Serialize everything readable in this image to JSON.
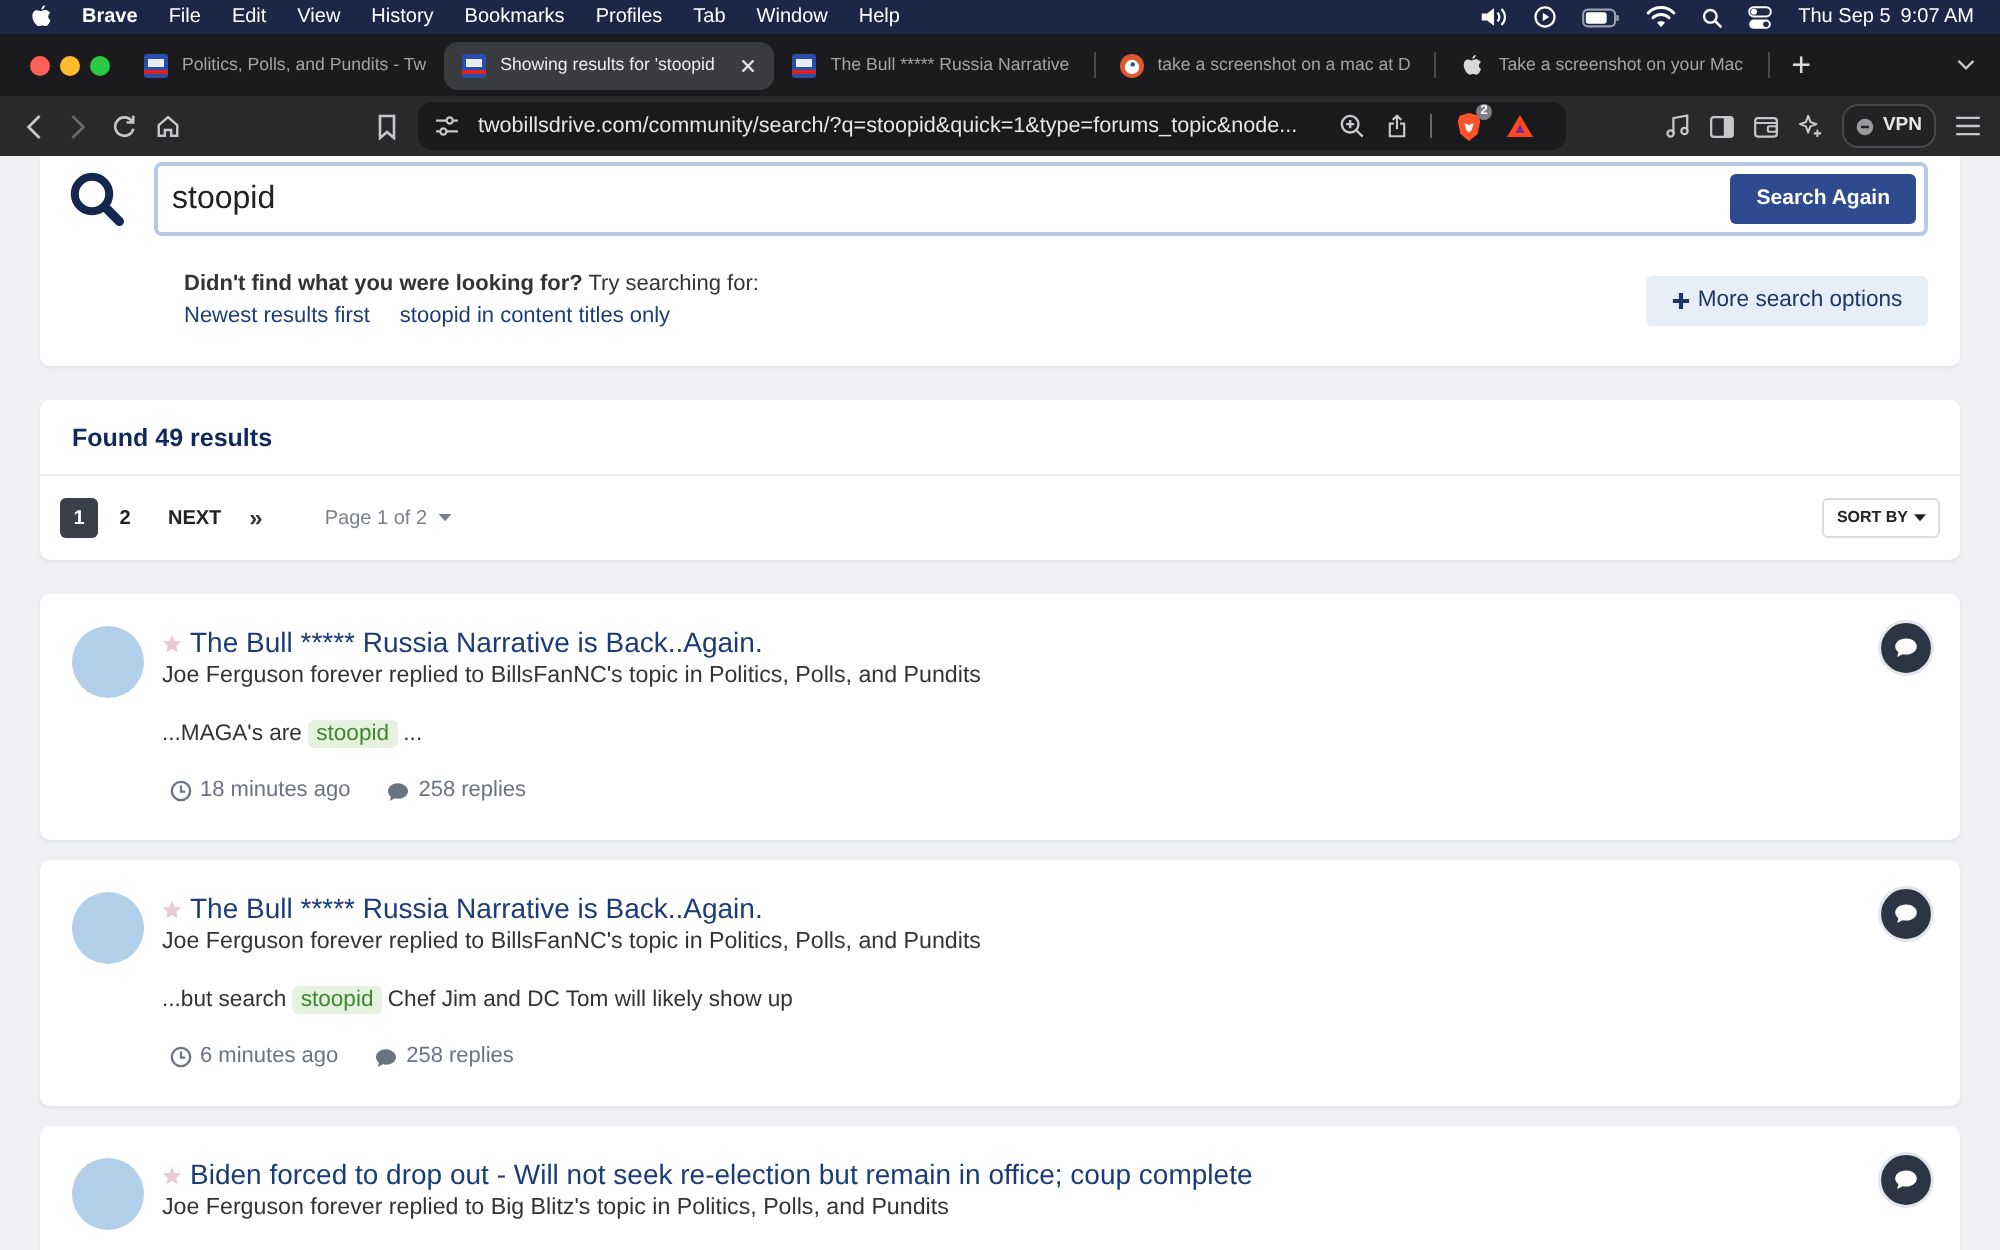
{
  "menu_bar": {
    "app": "Brave",
    "menus": [
      "File",
      "Edit",
      "View",
      "History",
      "Bookmarks",
      "Profiles",
      "Tab",
      "Window",
      "Help"
    ],
    "date": "Thu Sep 5",
    "time": "9:07 AM"
  },
  "browser_tabs": [
    {
      "kind": "site",
      "title": "Politics, Polls, and Pundits - Tw",
      "selected": false
    },
    {
      "kind": "site",
      "title": "Showing results for 'stoopid",
      "selected": true
    },
    {
      "kind": "site",
      "title": "The Bull ***** Russia Narrative",
      "selected": false
    },
    {
      "kind": "round",
      "title": "take a screenshot on a mac at D",
      "selected": false
    },
    {
      "kind": "apple",
      "title": "Take a screenshot on your Mac",
      "selected": false
    }
  ],
  "new_tab": "+",
  "toolbar": {
    "forward_disabled": true,
    "url": "twobillsdrive.com/community/search/?q=stoopid&quick=1&type=forums_topic&node...",
    "shields_count": "2",
    "vpn": "VPN"
  },
  "search": {
    "query": "stoopid",
    "button": "Search Again",
    "hint": "**Didn't find what you were looking for?** Try searching for:",
    "suggestions": [
      "Newest results first",
      "stoopid in content titles only"
    ],
    "more_options": "More search options"
  },
  "results_header": {
    "title": "Found 49 results",
    "pages": [
      {
        "label": "1",
        "selected": true
      },
      {
        "label": "2",
        "selected": false
      }
    ],
    "next": "NEXT",
    "last": "»",
    "page_jump": "Page 1 of 2",
    "sort": "SORT BY"
  },
  "results": [
    {
      "title": "The Bull ***** Russia Narrative is Back..Again.",
      "byline": "Joe Ferguson forever replied to BillsFanNC's topic in Politics, Polls, and Pundits",
      "snippet": {
        "before": "...MAGA's are ",
        "match": "stoopid",
        "after": " ..."
      },
      "time": "18 minutes ago",
      "replies": "258 replies"
    },
    {
      "title": "The Bull ***** Russia Narrative is Back..Again.",
      "byline": "Joe Ferguson forever replied to BillsFanNC's topic in Politics, Polls, and Pundits",
      "snippet": {
        "before": "...but search ",
        "match": "stoopid",
        "after": " Chef Jim and DC Tom will likely show up"
      },
      "time": "6 minutes ago",
      "replies": "258 replies"
    },
    {
      "title": "Biden forced to drop out - Will not seek re-election but remain in office; coup complete",
      "byline": "Joe Ferguson forever replied to Big Blitz's topic in Politics, Polls, and Pundits"
    }
  ]
}
